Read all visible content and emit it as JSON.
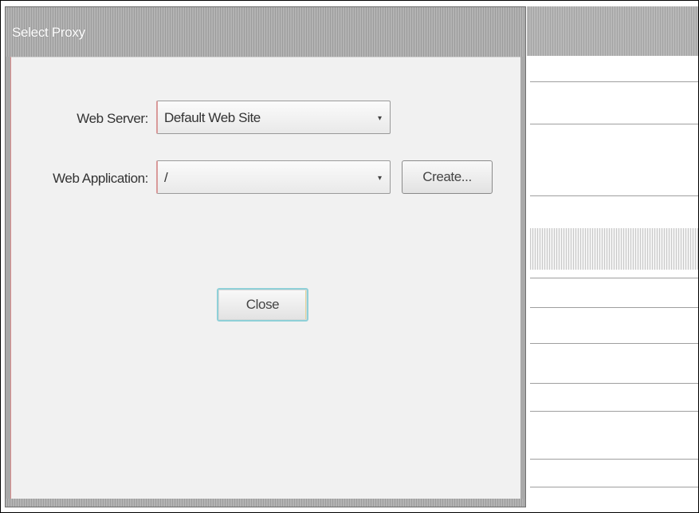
{
  "dialog": {
    "title": "Select Proxy",
    "web_server_label": "Web Server:",
    "web_server_value": "Default Web Site",
    "web_application_label": "Web Application:",
    "web_application_value": "/",
    "create_button": "Create...",
    "close_button": "Close",
    "dropdown_glyph": "▾"
  },
  "colors": {
    "titlebar": "#a9a9a9",
    "client": "#f1f1f1",
    "focus_ring": "#8fd0d8"
  }
}
